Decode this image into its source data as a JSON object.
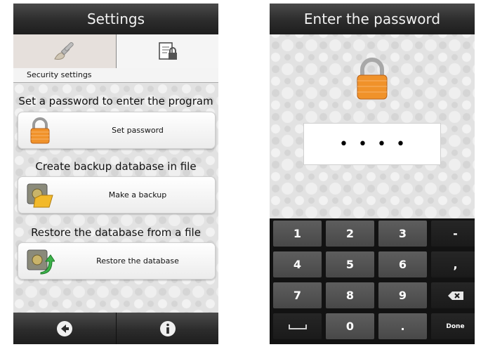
{
  "settings_screen": {
    "title": "Settings",
    "tabs": [
      {
        "icon": "paint-brush-icon"
      },
      {
        "icon": "document-lock-icon"
      }
    ],
    "section_label": "Security settings",
    "sections": [
      {
        "heading": "Set a password to enter the program",
        "button_label": "Set password",
        "icon": "padlock-icon"
      },
      {
        "heading": "Create backup database in file",
        "button_label": "Make a backup",
        "icon": "safe-folder-icon"
      },
      {
        "heading": "Restore the database from a file",
        "button_label": "Restore the database",
        "icon": "safe-arrow-icon"
      }
    ],
    "bottom_bar": {
      "back_icon": "back-arrow-icon",
      "info_icon": "info-icon"
    }
  },
  "password_screen": {
    "title": "Enter the password",
    "password_mask": "••••",
    "keys": [
      [
        "1",
        "2",
        "3",
        "-"
      ],
      [
        "4",
        "5",
        "6",
        ","
      ],
      [
        "7",
        "8",
        "9",
        ""
      ],
      [
        "",
        "0",
        ".",
        "Done"
      ]
    ],
    "special_keys": {
      "backspace_icon": "backspace-icon",
      "space_icon": "space-bar-icon"
    }
  },
  "colors": {
    "bar_dark": "#2c2c2c",
    "background": "#e2e2e2",
    "lock_orange": "#f0922a",
    "done_accent": "#2e6db0"
  }
}
